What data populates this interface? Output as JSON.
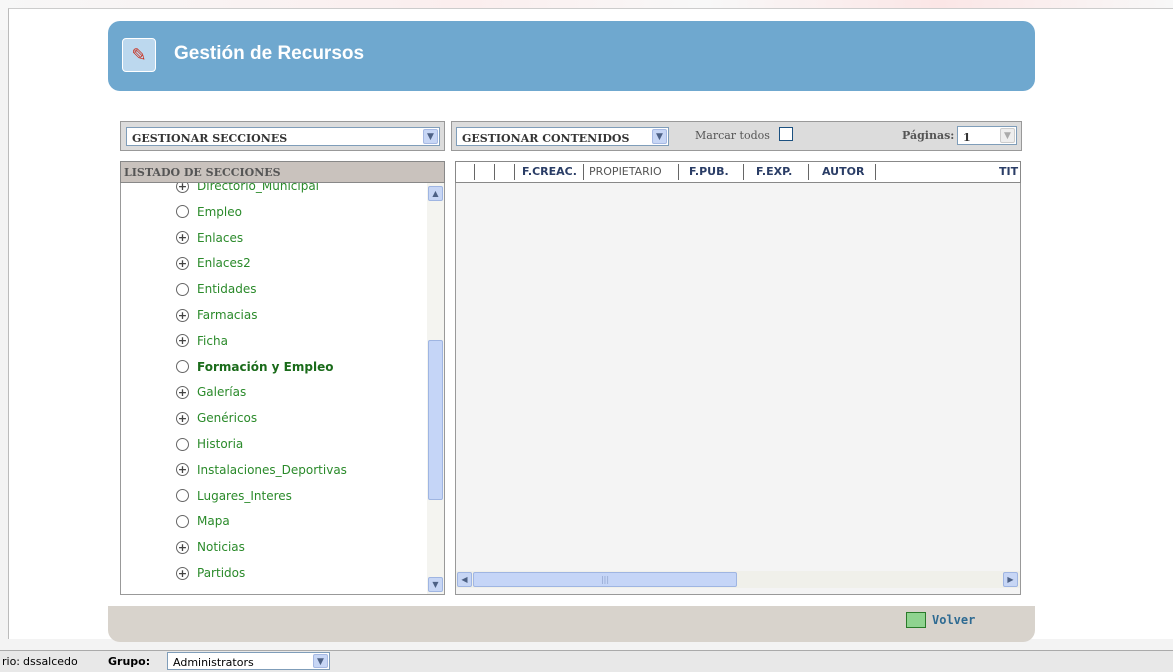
{
  "header": {
    "title": "Gestión de Recursos"
  },
  "left_toolbar": {
    "select_value": "GESTIONAR SECCIONES"
  },
  "right_toolbar": {
    "select_value": "GESTIONAR CONTENIDOS",
    "mark_all_label": "Marcar todos",
    "pages_label": "Páginas:",
    "pages_value": "1"
  },
  "sections": {
    "header": "LISTADO DE SECCIONES",
    "items": [
      {
        "label": "Directorio_Municipal",
        "type": "expand"
      },
      {
        "label": "Empleo",
        "type": "leaf"
      },
      {
        "label": "Enlaces",
        "type": "expand"
      },
      {
        "label": "Enlaces2",
        "type": "expand"
      },
      {
        "label": "Entidades",
        "type": "leaf"
      },
      {
        "label": "Farmacias",
        "type": "expand"
      },
      {
        "label": "Ficha",
        "type": "expand"
      },
      {
        "label": "Formación y Empleo",
        "type": "leaf",
        "selected": true
      },
      {
        "label": "Galerías",
        "type": "expand"
      },
      {
        "label": "Genéricos",
        "type": "expand"
      },
      {
        "label": "Historia",
        "type": "leaf"
      },
      {
        "label": "Instalaciones_Deportivas",
        "type": "expand"
      },
      {
        "label": "Lugares_Interes",
        "type": "leaf"
      },
      {
        "label": "Mapa",
        "type": "leaf"
      },
      {
        "label": "Noticias",
        "type": "expand"
      },
      {
        "label": "Partidos",
        "type": "expand"
      }
    ]
  },
  "grid": {
    "columns": [
      "F.CREAC.",
      "PROPIETARIO",
      "F.PUB.",
      "F.EXP.",
      "AUTOR",
      "TIT"
    ]
  },
  "footer": {
    "back_label": "Volver"
  },
  "status": {
    "user_label": "rio:",
    "user_value": "dssalcedo",
    "group_label": "Grupo:",
    "group_value": "Administrators"
  },
  "colors": {
    "header_bg": "#6fa8cf",
    "link_green": "#2a8a2a",
    "footer_bg": "#d8d3cc"
  }
}
